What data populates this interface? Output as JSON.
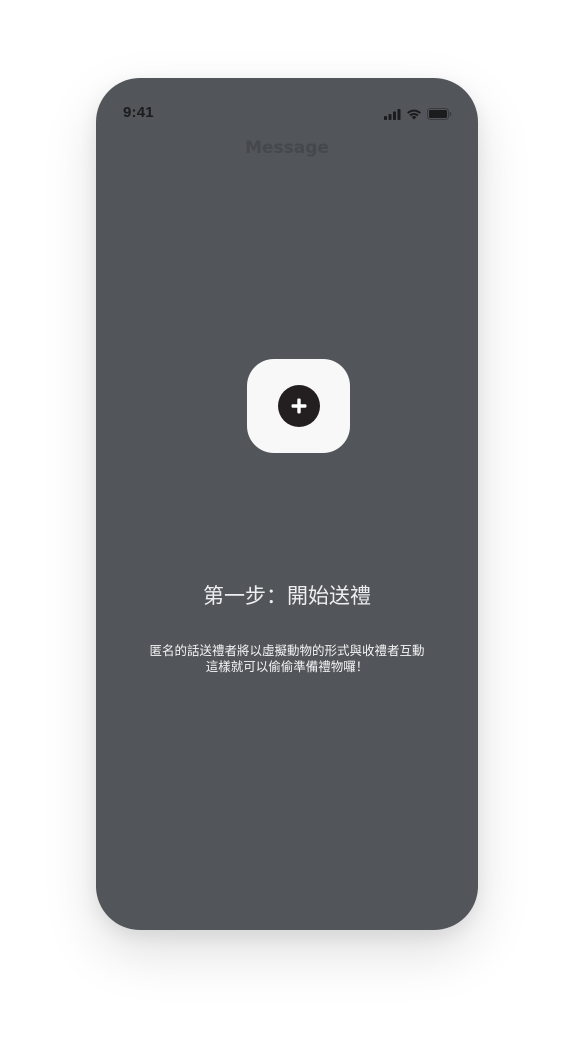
{
  "status_bar": {
    "time": "9:41",
    "icons": [
      "cellular-signal-icon",
      "wifi-icon",
      "battery-icon"
    ]
  },
  "nav": {
    "title": "Message"
  },
  "add_gift": {
    "icon": "plus-icon"
  },
  "heading": "第一步：開始送禮",
  "description": {
    "line1": "匿名的話送禮者將以虛擬動物的形式與收禮者互動",
    "line2": "這樣就可以偷偷準備禮物囉！"
  },
  "colors": {
    "screen_background": "#525559",
    "tile_background": "#f8f8f8",
    "plus_circle": "#231f20",
    "text": "#eceef0"
  }
}
